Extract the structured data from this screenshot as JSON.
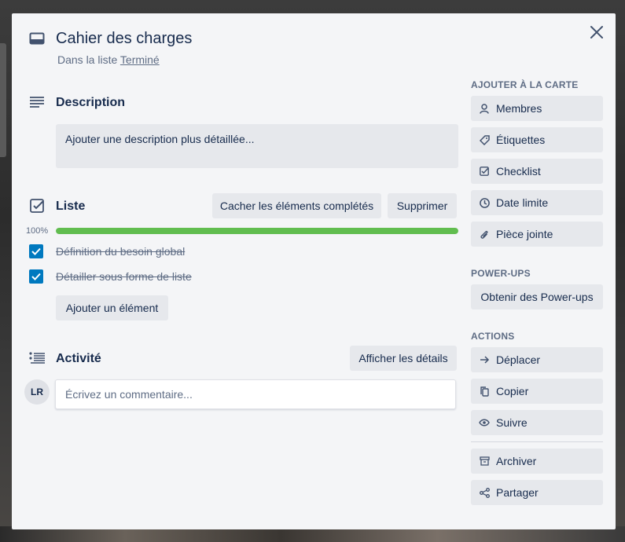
{
  "card": {
    "title": "Cahier des charges",
    "list_prefix": "Dans la liste",
    "list_name": "Terminé"
  },
  "description": {
    "title": "Description",
    "placeholder": "Ajouter une description plus détaillée..."
  },
  "checklist": {
    "title": "Liste",
    "hide_completed_label": "Cacher les éléments complétés",
    "delete_label": "Supprimer",
    "progress_text": "100%",
    "progress": 1.0,
    "items": [
      {
        "label": "Définition du besoin global",
        "checked": true
      },
      {
        "label": "Détailler sous forme de liste",
        "checked": true
      }
    ],
    "add_item_label": "Ajouter un élément"
  },
  "activity": {
    "title": "Activité",
    "show_details_label": "Afficher les détails",
    "avatar_initials": "LR",
    "comment_placeholder": "Écrivez un commentaire..."
  },
  "sidebar": {
    "add_to_card_heading": "AJOUTER À LA CARTE",
    "add_to_card": [
      {
        "label": "Membres",
        "icon": "person-icon"
      },
      {
        "label": "Étiquettes",
        "icon": "tag-icon"
      },
      {
        "label": "Checklist",
        "icon": "checklist-icon"
      },
      {
        "label": "Date limite",
        "icon": "clock-icon"
      },
      {
        "label": "Pièce jointe",
        "icon": "paperclip-icon"
      }
    ],
    "powerups_heading": "POWER-UPS",
    "get_powerups_label": "Obtenir des Power-ups",
    "actions_heading": "ACTIONS",
    "actions": [
      {
        "label": "Déplacer",
        "icon": "arrow-right-icon"
      },
      {
        "label": "Copier",
        "icon": "copy-icon"
      },
      {
        "label": "Suivre",
        "icon": "eye-icon"
      },
      {
        "label": "Archiver",
        "icon": "archive-icon"
      },
      {
        "label": "Partager",
        "icon": "share-icon"
      }
    ]
  },
  "colors": {
    "progress_fill": "#61bd4f",
    "checkbox": "#0079bf",
    "modal_bg": "#f4f5f7",
    "button_bg": "#e6e8ec"
  }
}
